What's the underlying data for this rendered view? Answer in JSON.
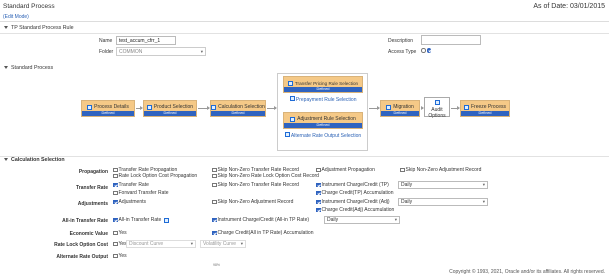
{
  "header": {
    "title": "Standard Process",
    "edit_mode": "(Edit Mode)",
    "as_of": "As of Date: 03/01/2015"
  },
  "rule_section": {
    "heading": "TP Standard Process Rule",
    "name_label": "Name",
    "name_value": "test_accum_cfrr_1",
    "folder_label": "Folder",
    "folder_value": "COMMON",
    "description_label": "Description",
    "description_value": "",
    "access_type_label": "Access Type"
  },
  "process_section": {
    "heading": "Standard Process",
    "nodes": {
      "process_details": {
        "label": "Process Details",
        "status": "Defined"
      },
      "product_selection": {
        "label": "Product Selection",
        "status": "Defined"
      },
      "calculation_selection": {
        "label": "Calculation Selection",
        "status": "Defined"
      },
      "transfer_pricing_rule": {
        "label": "Transfer Pricing Rule Selection",
        "status": "Defined"
      },
      "prepayment_rule": {
        "label": "Prepayment Rule Selection"
      },
      "adjustment_rule": {
        "label": "Adjustment Rule Selection",
        "status": "Defined"
      },
      "alternate_rate": {
        "label": "Alternate Rate Output Selection"
      },
      "migration": {
        "label": "Migration",
        "status": "Defined"
      },
      "audit_options": {
        "label": "Audit Options"
      },
      "freeze_process": {
        "label": "Freeze Process",
        "status": "Defined"
      }
    }
  },
  "calc_section": {
    "heading": "Calculation Selection",
    "rows": {
      "propagation": "Propagation",
      "transfer_rate": "Transfer Rate",
      "adjustments": "Adjustments",
      "all_in_transfer_rate": "All-in Transfer Rate",
      "economic_value": "Economic Value",
      "rate_lock_option_cost": "Rate Lock Option Cost",
      "alternate_rate_output": "Alternate Rate Output"
    },
    "options": {
      "transfer_rate_propagation": "Transfer Rate Propagation",
      "rate_lock_option_cost_propagation": "Rate Lock Option Cost Propagation",
      "skip_non_zero_tr_record": "Skip Non-Zero Transfer Rate Record",
      "skip_non_zero_rlo_record": "Skip Non-Zero Rate Lock Option Cost Record",
      "adjustment_propagation": "Adjustment Propagation",
      "skip_non_zero_adj_record_prop": "Skip Non-Zero Adjustment Record",
      "transfer_rate": "Transfer Rate",
      "forward_transfer_rate": "Forward Transfer Rate",
      "skip_non_zero_tr_record_2": "Skip Non-Zero Transfer Rate Record",
      "instrument_charge_tp": "Instrument Charge/Credit (TP)",
      "charge_credit_tp_accum": "Charge Credit(TP) Accumulation",
      "adjustments": "Adjustments",
      "skip_non_zero_adj_record": "Skip Non-Zero Adjustment Record",
      "instrument_charge_adj": "Instrument Charge/Credit (Adj)",
      "charge_credit_adj_accum": "Charge Credit(Adj) Accumulation",
      "all_in_transfer_rate": "All-in Transfer Rate",
      "instrument_charge_all_in": "Instrument Charge/Credit (All-in TP Rate)",
      "charge_credit_all_in_accum": "Charge Credit(All in TP Rate) Accumulation",
      "economic_value_yes": "Yes",
      "rate_lock_yes": "Yes",
      "alternate_rate_yes": "Yes"
    },
    "dropdowns": {
      "tp_freq": "Daily",
      "adj_freq": "Daily",
      "all_in_freq": "Daily",
      "discount_curve": "Discount Curve",
      "volatility_curve": "Volatility Curve"
    }
  },
  "footer": {
    "copyright": "Copyright © 1993, 2021, Oracle and/or its affiliates. All rights reserved.",
    "zoom": "98%"
  }
}
